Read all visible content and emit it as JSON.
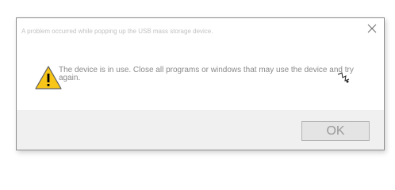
{
  "window": {
    "title": "A problem occurred while popping up the USB mass storage device."
  },
  "message": {
    "text": "The device is in use. Close all programs or windows that may use the device and try again."
  },
  "buttons": {
    "ok_label": "OK"
  },
  "icons": {
    "warning": "warning-triangle-icon",
    "close": "close-icon",
    "cursor": "busy-cursor-icon"
  },
  "colors": {
    "warning_fill": "#f7c619",
    "footer_bg": "#f0f0f0",
    "text": "#8a8a8a"
  }
}
